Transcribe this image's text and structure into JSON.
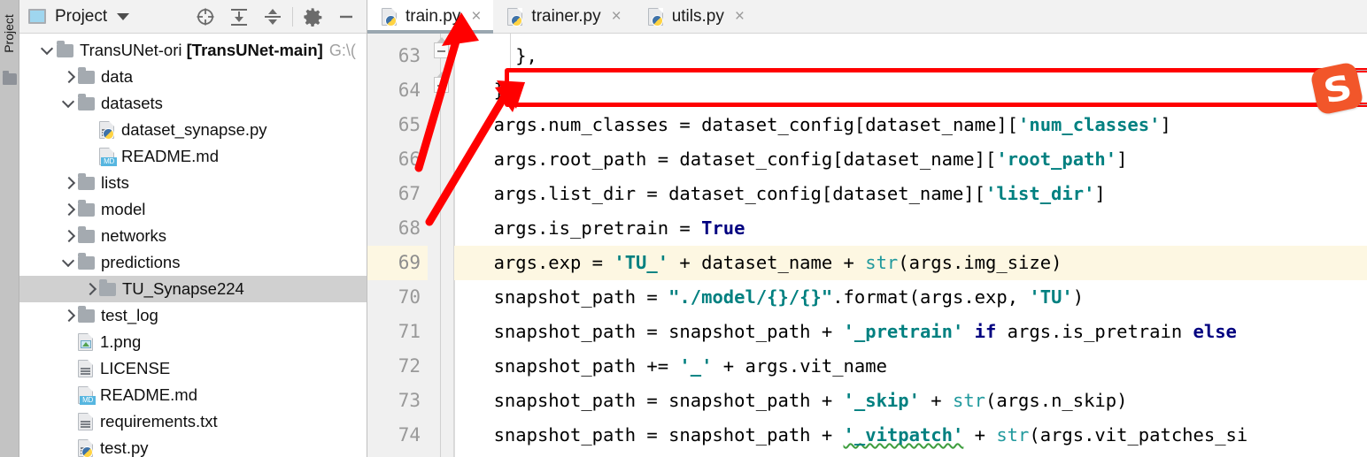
{
  "toolstrip": {
    "label": "Project",
    "icon": "folder-icon"
  },
  "panel": {
    "title": "Project",
    "icons": [
      "locate-icon",
      "expand-all-icon",
      "collapse-all-icon",
      "settings-gear-icon",
      "hide-icon"
    ]
  },
  "tree": [
    {
      "indent": 0,
      "arrow": "down",
      "icon": "folder-icon",
      "label": "TransUNet-ori ",
      "bold": "[TransUNet-main]",
      "path": "G:\\(",
      "selected": false
    },
    {
      "indent": 1,
      "arrow": "right",
      "icon": "folder-icon",
      "label": "data",
      "selected": false
    },
    {
      "indent": 1,
      "arrow": "down",
      "icon": "folder-icon",
      "label": "datasets",
      "selected": false
    },
    {
      "indent": 2,
      "arrow": "none",
      "icon": "python-file-icon",
      "label": "dataset_synapse.py",
      "selected": false
    },
    {
      "indent": 2,
      "arrow": "none",
      "icon": "markdown-file-icon",
      "label": "README.md",
      "selected": false
    },
    {
      "indent": 1,
      "arrow": "right",
      "icon": "folder-icon",
      "label": "lists",
      "selected": false
    },
    {
      "indent": 1,
      "arrow": "right",
      "icon": "folder-icon",
      "label": "model",
      "selected": false
    },
    {
      "indent": 1,
      "arrow": "right",
      "icon": "folder-icon",
      "label": "networks",
      "selected": false
    },
    {
      "indent": 1,
      "arrow": "down",
      "icon": "folder-icon",
      "label": "predictions",
      "selected": false
    },
    {
      "indent": 2,
      "arrow": "right",
      "icon": "folder-icon",
      "label": "TU_Synapse224",
      "selected": true
    },
    {
      "indent": 1,
      "arrow": "right",
      "icon": "folder-icon",
      "label": "test_log",
      "selected": false
    },
    {
      "indent": 1,
      "arrow": "none",
      "icon": "image-file-icon",
      "label": "1.png",
      "selected": false
    },
    {
      "indent": 1,
      "arrow": "none",
      "icon": "text-file-icon",
      "label": "LICENSE",
      "selected": false
    },
    {
      "indent": 1,
      "arrow": "none",
      "icon": "markdown-file-icon",
      "label": "README.md",
      "selected": false
    },
    {
      "indent": 1,
      "arrow": "none",
      "icon": "text-file-icon",
      "label": "requirements.txt",
      "selected": false
    },
    {
      "indent": 1,
      "arrow": "none",
      "icon": "python-file-icon",
      "label": "test.py",
      "selected": false
    }
  ],
  "tabs": [
    {
      "label": "train.py",
      "icon": "python-file-icon",
      "active": true,
      "close": "×"
    },
    {
      "label": "trainer.py",
      "icon": "python-file-icon",
      "active": false,
      "close": "×"
    },
    {
      "label": "utils.py",
      "icon": "python-file-icon",
      "active": false,
      "close": "×"
    }
  ],
  "editor": {
    "line_numbers": [
      "63",
      "64",
      "65",
      "66",
      "67",
      "68",
      "69",
      "70",
      "71",
      "72",
      "73",
      "74"
    ],
    "current_line": "69",
    "lines": [
      {
        "num": "63",
        "indent": 4,
        "tokens": [
          {
            "t": "},",
            "c": "plain"
          }
        ]
      },
      {
        "num": "64",
        "indent": 2,
        "tokens": [
          {
            "t": "}",
            "c": "plain"
          }
        ]
      },
      {
        "num": "65",
        "indent": 2,
        "tokens": [
          {
            "t": "args.num_classes = dataset_config[dataset_name][",
            "c": "plain"
          },
          {
            "t": "'num_classes'",
            "c": "string"
          },
          {
            "t": "]",
            "c": "plain"
          }
        ]
      },
      {
        "num": "66",
        "indent": 2,
        "tokens": [
          {
            "t": "args.root_path = dataset_config[dataset_name][",
            "c": "plain"
          },
          {
            "t": "'root_path'",
            "c": "string"
          },
          {
            "t": "]",
            "c": "plain"
          }
        ]
      },
      {
        "num": "67",
        "indent": 2,
        "tokens": [
          {
            "t": "args.list_dir = dataset_config[dataset_name][",
            "c": "plain"
          },
          {
            "t": "'list_dir'",
            "c": "string"
          },
          {
            "t": "]",
            "c": "plain"
          }
        ]
      },
      {
        "num": "68",
        "indent": 2,
        "tokens": [
          {
            "t": "args.is_pretrain = ",
            "c": "plain"
          },
          {
            "t": "True",
            "c": "keyword"
          }
        ]
      },
      {
        "num": "69",
        "indent": 2,
        "tokens": [
          {
            "t": "args.exp = ",
            "c": "plain"
          },
          {
            "t": "'TU_'",
            "c": "string"
          },
          {
            "t": " + dataset_name + ",
            "c": "plain"
          },
          {
            "t": "str",
            "c": "builtin"
          },
          {
            "t": "(args.img_size)",
            "c": "plain"
          }
        ]
      },
      {
        "num": "70",
        "indent": 2,
        "tokens": [
          {
            "t": "snapshot_path = ",
            "c": "plain"
          },
          {
            "t": "\"./model/{}/{}\"",
            "c": "string"
          },
          {
            "t": ".format(args.exp, ",
            "c": "plain"
          },
          {
            "t": "'TU'",
            "c": "string"
          },
          {
            "t": ")",
            "c": "plain"
          }
        ]
      },
      {
        "num": "71",
        "indent": 2,
        "tokens": [
          {
            "t": "snapshot_path = snapshot_path + ",
            "c": "plain"
          },
          {
            "t": "'_pretrain'",
            "c": "string"
          },
          {
            "t": " ",
            "c": "plain"
          },
          {
            "t": "if",
            "c": "keyword"
          },
          {
            "t": " args.is_pretrain ",
            "c": "plain"
          },
          {
            "t": "else",
            "c": "keyword"
          }
        ]
      },
      {
        "num": "72",
        "indent": 2,
        "tokens": [
          {
            "t": "snapshot_path += ",
            "c": "plain"
          },
          {
            "t": "'_'",
            "c": "string"
          },
          {
            "t": " + args.vit_name",
            "c": "plain"
          }
        ]
      },
      {
        "num": "73",
        "indent": 2,
        "tokens": [
          {
            "t": "snapshot_path = snapshot_path + ",
            "c": "plain"
          },
          {
            "t": "'_skip'",
            "c": "string"
          },
          {
            "t": " + ",
            "c": "plain"
          },
          {
            "t": "str",
            "c": "builtin"
          },
          {
            "t": "(args.n_skip)",
            "c": "plain"
          }
        ]
      },
      {
        "num": "74",
        "indent": 2,
        "tokens": [
          {
            "t": "snapshot_path = snapshot_path + ",
            "c": "plain"
          },
          {
            "t": "'_vitpatch'",
            "c": "string-typo"
          },
          {
            "t": " + ",
            "c": "plain"
          },
          {
            "t": "str",
            "c": "builtin"
          },
          {
            "t": "(args.vit_patches_si",
            "c": "plain"
          }
        ]
      }
    ]
  },
  "annotations": {
    "highlight_box_line": "70",
    "box_color": "#ff0000",
    "arrow_color": "#ff0000",
    "arrows": [
      {
        "name": "arrow-to-train-tab",
        "from": "line-66-gutter",
        "to": "tab-train-py"
      },
      {
        "name": "arrow-to-snapshot-line",
        "from": "line-73-gutter",
        "to": "line-70-code"
      }
    ]
  },
  "floating": {
    "sogou_logo": "S",
    "name": "sogou-ime-logo"
  },
  "colors": {
    "accent_red": "#ff0000",
    "string": "#008080",
    "keyword": "#000080",
    "builtin": "#20999d",
    "current_line_bg": "#fdf7e2",
    "selection_bg": "#d0d0d0",
    "panel_bg": "#f2f2f2",
    "gutter_bg": "#f0f0f0",
    "sogou_orange": "#f2562a"
  }
}
